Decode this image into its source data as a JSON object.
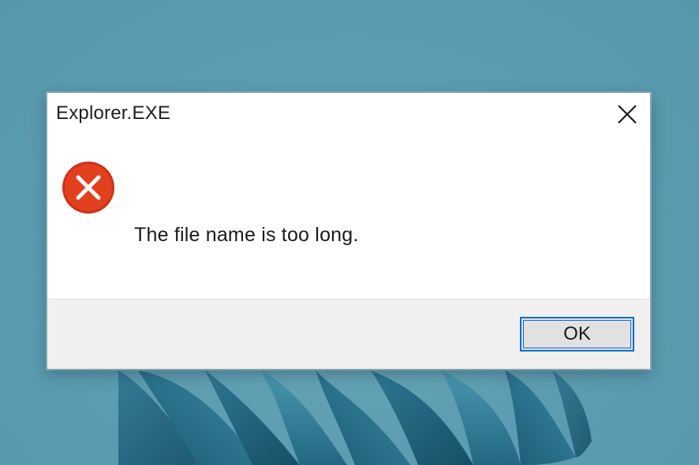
{
  "dialog": {
    "title": "Explorer.EXE",
    "message": "The file name is too long.",
    "ok_label": "OK",
    "icon": "error-icon",
    "close_icon": "close-icon"
  },
  "colors": {
    "desktop_background": "#5d9db1",
    "wallpaper_ribbon": "#1f5f7a",
    "error_red": "#e3401f",
    "focus_blue": "#0a6ed1",
    "button_bar": "#f0f0f0"
  }
}
